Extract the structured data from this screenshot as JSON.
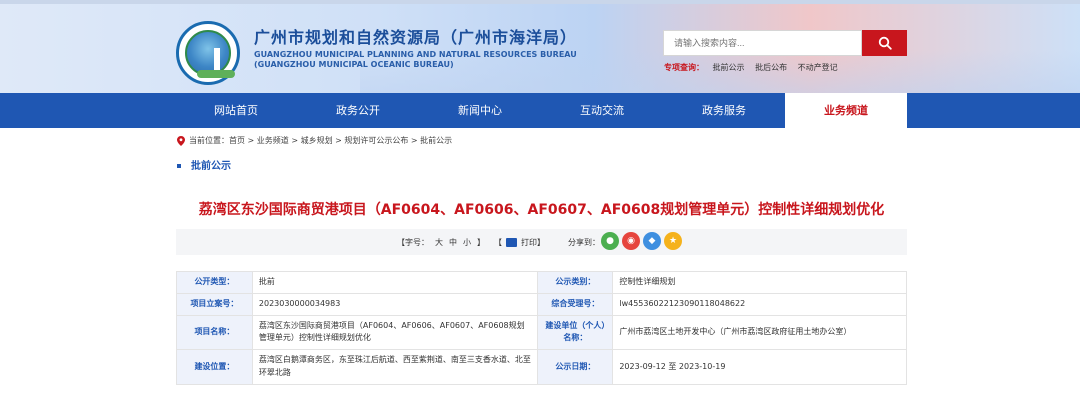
{
  "header": {
    "title": "广州市规划和自然资源局（广州市海洋局）",
    "en_line1": "GUANGZHOU MUNICIPAL PLANNING AND NATURAL RESOURCES BUREAU",
    "en_line2": "(GUANGZHOU MUNICIPAL OCEANIC BUREAU)",
    "search_placeholder": "请输入搜索内容...",
    "quick_label": "专项查询：",
    "quick_links": [
      "批前公示",
      "批后公布",
      "不动产登记"
    ]
  },
  "nav": {
    "items": [
      "网站首页",
      "政务公开",
      "新闻中心",
      "互动交流",
      "政务服务",
      "业务频道"
    ],
    "active": "业务频道"
  },
  "breadcrumb": "当前位置：首页 > 业务频道 > 城乡规划 > 规划许可公示公布 > 批前公示",
  "section": "批前公示",
  "article": {
    "title": "荔湾区东沙国际商贸港项目（AF0604、AF0606、AF0607、AF0608规划管理单元）控制性详细规划优化"
  },
  "tools": {
    "font_open": "【字号：",
    "font_big": "大",
    "font_mid": "中",
    "font_small": "小",
    "font_close": "】",
    "print_open": "【",
    "print_label": "打印",
    "print_close": "】",
    "share_label": "分享到："
  },
  "info": {
    "rows": [
      {
        "l1": "公开类型：",
        "v1": "批前",
        "l2": "公示类别：",
        "v2": "控制性详细规划"
      },
      {
        "l1": "项目立案号：",
        "v1": "2023030000034983",
        "l2": "综合受理号：",
        "v2": "lw455360221230901180486​22"
      },
      {
        "l1": "项目名称：",
        "v1": "荔湾区东沙国际商贸港项目（AF0604、AF0606、AF0607、AF0608规划管理单元）控制性详细规划优化",
        "l2": "建设单位（个人）名称：",
        "v2": "广州市荔湾区土地开发中心（广州市荔湾区政府征用土地办公室）"
      },
      {
        "l1": "建设位置：",
        "v1": "荔湾区白鹅潭商务区，东至珠江后航道、西至紫荆道、南至三支香水道、北至环翠北路",
        "l2": "公示日期：",
        "v2": "2023-09-12 至 2023-10-19"
      }
    ]
  },
  "colors": {
    "brand_blue": "#1f57b3",
    "accent_red": "#c8161d"
  },
  "icons": [
    "location-pin-icon",
    "search-icon",
    "print-icon",
    "wechat-icon",
    "weibo-icon",
    "qq-icon",
    "qzone-icon"
  ]
}
